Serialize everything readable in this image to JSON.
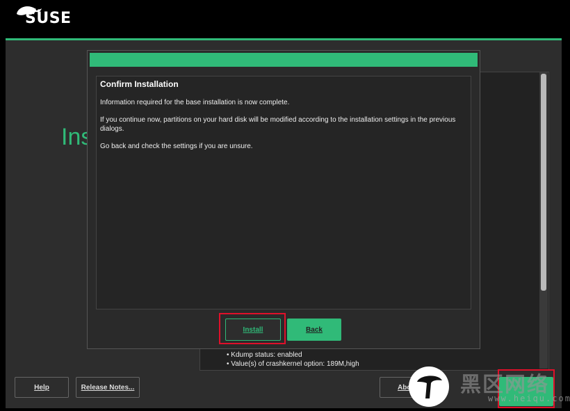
{
  "header": {
    "logo_text": "SUSE"
  },
  "background": {
    "title_fragment": "Ins",
    "summary_lines": [
      "Kdump status: enabled",
      "Value(s) of crashkernel option: 189M,high"
    ]
  },
  "bottom_buttons": {
    "help": "Help",
    "release_notes": "Release Notes...",
    "abort_fragment": "Abo"
  },
  "dialog": {
    "title": "Confirm Installation",
    "paragraphs": [
      "Information required for the base installation is now complete.",
      "If you continue now, partitions on your hard disk will be modified according to the installation settings in the previous dialogs.",
      "Go back and check the settings if you are unsure."
    ],
    "install_label": "Install",
    "back_label": "Back"
  },
  "watermark": {
    "text": "黑区网络",
    "sub": "www.heiqu.com"
  },
  "colors": {
    "accent": "#30ba78",
    "focus": "#e0102a",
    "background": "#2d2d2d"
  }
}
